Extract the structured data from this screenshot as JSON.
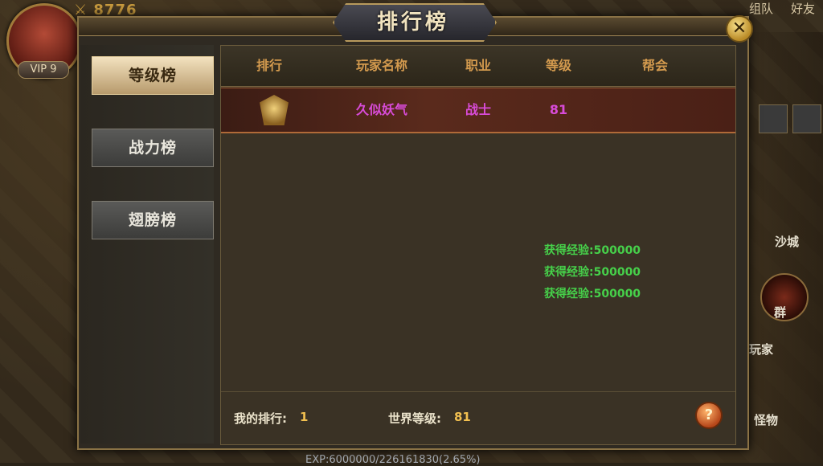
{
  "hud": {
    "power_value": "8776",
    "vip_label": "VIP 9",
    "top_right": [
      "组队",
      "好友"
    ],
    "exp_text": "EXP:6000000/226161830(2.65%)",
    "right_labels": [
      "沙城",
      "群",
      "玩家",
      "怪物"
    ]
  },
  "panel": {
    "title": "排行榜",
    "close_icon": "close-icon"
  },
  "sidebar": {
    "items": [
      {
        "label": "等级榜",
        "active": true
      },
      {
        "label": "战力榜",
        "active": false
      },
      {
        "label": "翅膀榜",
        "active": false
      }
    ]
  },
  "table": {
    "headers": [
      "排行",
      "玩家名称",
      "职业",
      "等级",
      "帮会"
    ],
    "rows": [
      {
        "rank_icon": "gold-crest-icon",
        "name": "久似妖气",
        "class": "战士",
        "level": "81",
        "guild": ""
      }
    ]
  },
  "rewards": [
    "获得经验:500000",
    "获得经验:500000",
    "获得经验:500000"
  ],
  "footer": {
    "my_rank_label": "我的排行:",
    "my_rank_value": "1",
    "world_level_label": "世界等级:",
    "world_level_value": "81",
    "help_icon": "help-icon"
  },
  "colors": {
    "header_text": "#d39a4e",
    "player_name": "#d84bd8",
    "reward_text": "#46d04a",
    "footer_value": "#f2c050"
  }
}
